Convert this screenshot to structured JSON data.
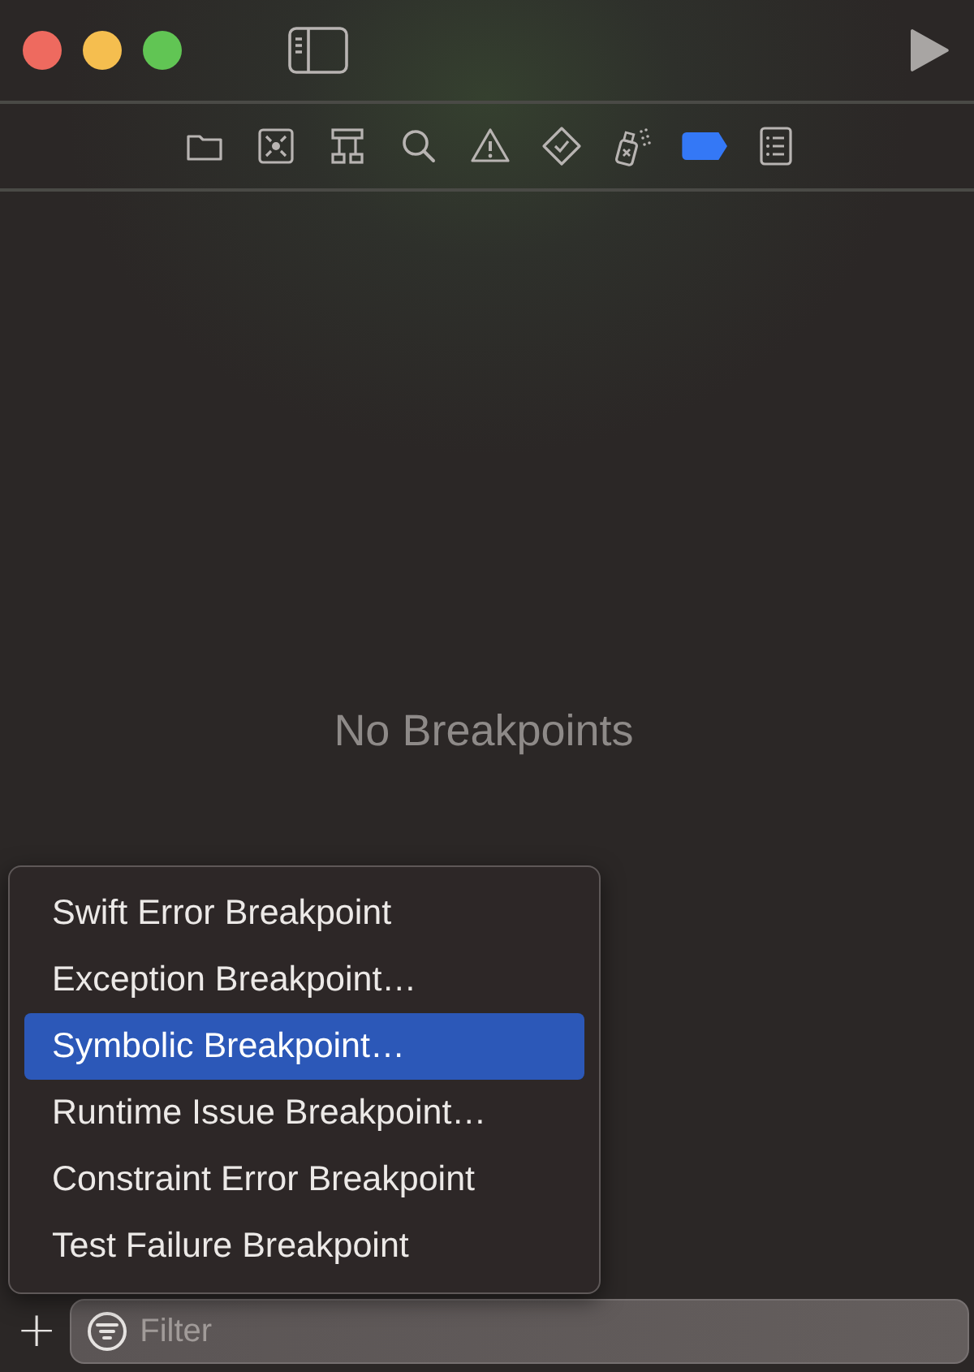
{
  "navigator_tabs": [
    {
      "kind": "folder",
      "selected": false
    },
    {
      "kind": "source-control",
      "selected": false
    },
    {
      "kind": "hierarchy",
      "selected": false
    },
    {
      "kind": "search",
      "selected": false
    },
    {
      "kind": "warning",
      "selected": false
    },
    {
      "kind": "test",
      "selected": false
    },
    {
      "kind": "debug",
      "selected": false
    },
    {
      "kind": "breakpoint",
      "selected": true
    },
    {
      "kind": "report",
      "selected": false
    }
  ],
  "empty_message": "No Breakpoints",
  "add_menu": {
    "items": [
      {
        "label": "Swift Error Breakpoint",
        "selected": false
      },
      {
        "label": "Exception Breakpoint…",
        "selected": false
      },
      {
        "label": "Symbolic Breakpoint…",
        "selected": true
      },
      {
        "label": "Runtime Issue Breakpoint…",
        "selected": false
      },
      {
        "label": "Constraint Error Breakpoint",
        "selected": false
      },
      {
        "label": "Test Failure Breakpoint",
        "selected": false
      }
    ]
  },
  "bottom_bar": {
    "add_button": "+",
    "filter": {
      "placeholder": "Filter"
    }
  }
}
